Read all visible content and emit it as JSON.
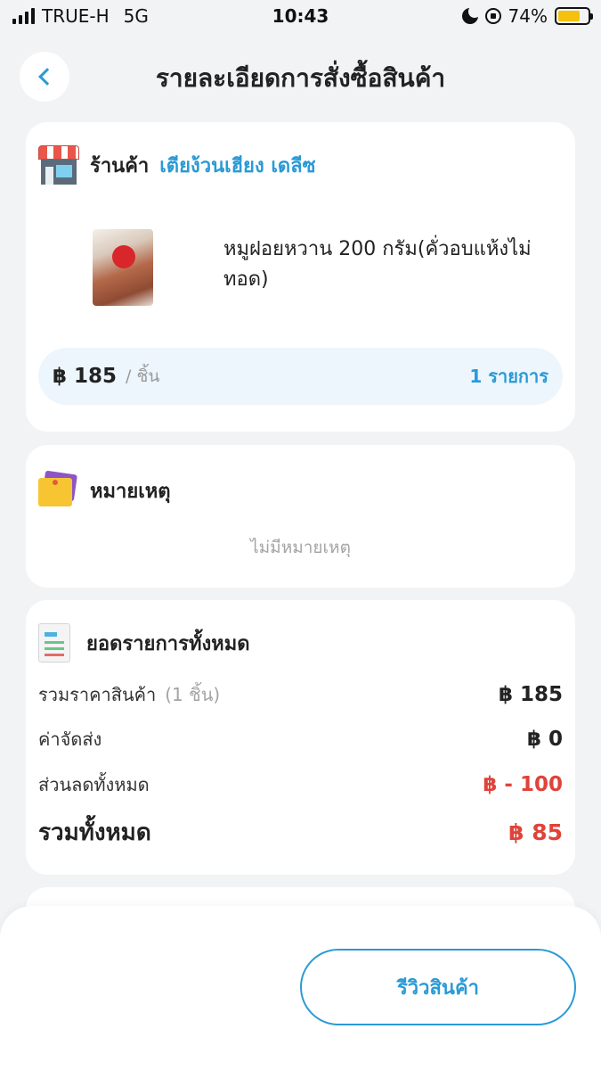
{
  "status_bar": {
    "carrier": "TRUE-H",
    "network": "5G",
    "time": "10:43",
    "battery": "74%",
    "battery_level": 0.74
  },
  "header": {
    "title": "รายละเอียดการสั่งซื้อสินค้า"
  },
  "store": {
    "label": "ร้านค้า",
    "name": "เตียง้วนเฮียง เดลีซ"
  },
  "product": {
    "name": "หมูฝอยหวาน 200 กรัม(คั่วอบแห้งไม่ทอด)",
    "price": "฿ 185",
    "unit": "/ ชิ้น",
    "quantity": "1 รายการ"
  },
  "note": {
    "title": "หมายเหตุ",
    "empty_text": "ไม่มีหมายเหตุ"
  },
  "summary": {
    "title": "ยอดรายการทั้งหมด",
    "subtotal_label": "รวมราคาสินค้า",
    "subtotal_count": "(1 ชิ้น)",
    "subtotal_value": "฿ 185",
    "shipping_label": "ค่าจัดส่ง",
    "shipping_value": "฿ 0",
    "discount_label": "ส่วนลดทั้งหมด",
    "discount_value": "฿ - 100",
    "total_label": "รวมทั้งหมด",
    "total_value": "฿ 85"
  },
  "actions": {
    "review_label": "รีวิวสินค้า"
  },
  "colors": {
    "accent": "#2a9ad6",
    "discount": "#e0433a",
    "background": "#f2f3f5"
  }
}
